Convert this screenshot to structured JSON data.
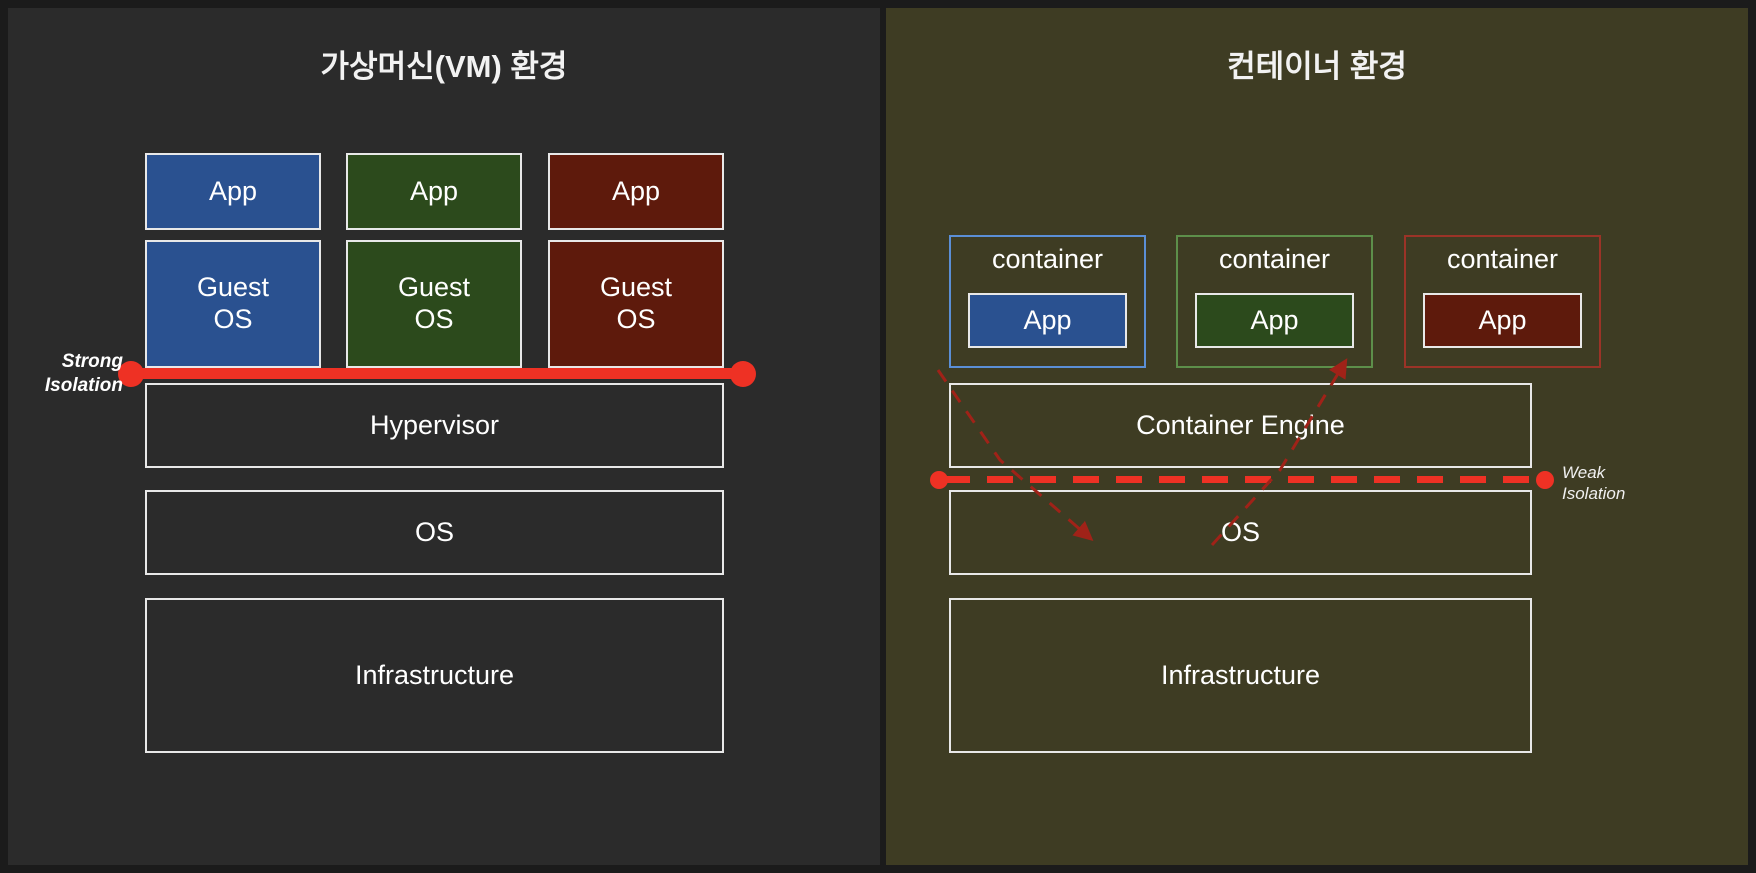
{
  "diagram": {
    "panels": [
      {
        "id": "vm",
        "title": "가상머신(VM) 환경",
        "apps": [
          {
            "label": "App",
            "color": "#2a5190"
          },
          {
            "label": "App",
            "color": "#2c4a1c"
          },
          {
            "label": "App",
            "color": "#5e1a0c"
          }
        ],
        "guest_os": [
          {
            "label": "Guest\nOS",
            "line1": "Guest",
            "line2": "OS",
            "color": "#2a5190"
          },
          {
            "label": "Guest\nOS",
            "line1": "Guest",
            "line2": "OS",
            "color": "#2c4a1c"
          },
          {
            "label": "Guest\nOS",
            "line1": "Guest",
            "line2": "OS",
            "color": "#5e1a0c"
          }
        ],
        "layers": [
          {
            "label": "Hypervisor"
          },
          {
            "label": "OS"
          },
          {
            "label": "Infrastructure"
          }
        ],
        "isolation": {
          "label_line1": "Strong",
          "label_line2": "Isolation",
          "style": "solid",
          "color": "#ee3124"
        }
      },
      {
        "id": "container",
        "title": "컨테이너 환경",
        "containers": [
          {
            "label": "container",
            "app_label": "App",
            "border": "#5b8fd6",
            "app_color": "#2a5190"
          },
          {
            "label": "container",
            "app_label": "App",
            "border": "#5d8f4a",
            "app_color": "#2c4a1c"
          },
          {
            "label": "container",
            "app_label": "App",
            "border": "#9b3327",
            "app_color": "#5e1a0c"
          }
        ],
        "layers": [
          {
            "label": "Container Engine"
          },
          {
            "label": "OS"
          },
          {
            "label": "Infrastructure"
          }
        ],
        "isolation": {
          "label_line1": "Weak",
          "label_line2": "Isolation",
          "style": "dashed",
          "color": "#ee3124"
        }
      }
    ],
    "colors": {
      "left_panel_background": "#2b2b2b",
      "right_panel_background": "#3e3c23",
      "page_background": "#1b1b1b",
      "box_border": "#e8e8e8",
      "isolation_red": "#ee3124",
      "arrow_red": "#a02218"
    }
  }
}
